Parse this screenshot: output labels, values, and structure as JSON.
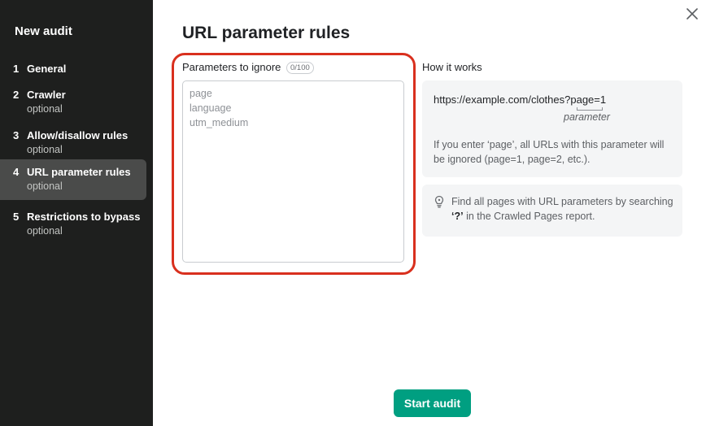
{
  "sidebar": {
    "title": "New audit",
    "steps": [
      {
        "num": "1",
        "label": "General",
        "sub": ""
      },
      {
        "num": "2",
        "label": "Crawler",
        "sub": "optional"
      },
      {
        "num": "3",
        "label": "Allow/disallow rules",
        "sub": "optional"
      },
      {
        "num": "4",
        "label": "URL parameter rules",
        "sub": "optional"
      },
      {
        "num": "5",
        "label": "Restrictions to bypass",
        "sub": "optional"
      }
    ]
  },
  "main": {
    "title": "URL parameter rules",
    "params": {
      "label": "Parameters to ignore",
      "counter": "0/100",
      "placeholder_lines": [
        "page",
        "language",
        "utm_medium"
      ]
    },
    "how": {
      "title": "How it works",
      "url_prefix": "https://example.com/clothes?",
      "url_param": "page",
      "url_suffix": "=1",
      "param_caption": "parameter",
      "description": "If you enter ‘page’, all URLs with this parameter will be ignored (page=1, page=2, etc.)."
    },
    "tip": {
      "text_before": "Find all pages with URL parameters by searching ",
      "highlight": "‘?’",
      "text_after": " in the Crawled Pages report."
    },
    "start_label": "Start audit"
  },
  "colors": {
    "sidebar_bg": "#1e1f1e",
    "active_step_bg": "#4a4b4a",
    "accent_green": "#009f81",
    "highlight_red": "#d9301e"
  },
  "icons": {
    "close": "close-icon",
    "tip": "lightbulb-icon"
  }
}
